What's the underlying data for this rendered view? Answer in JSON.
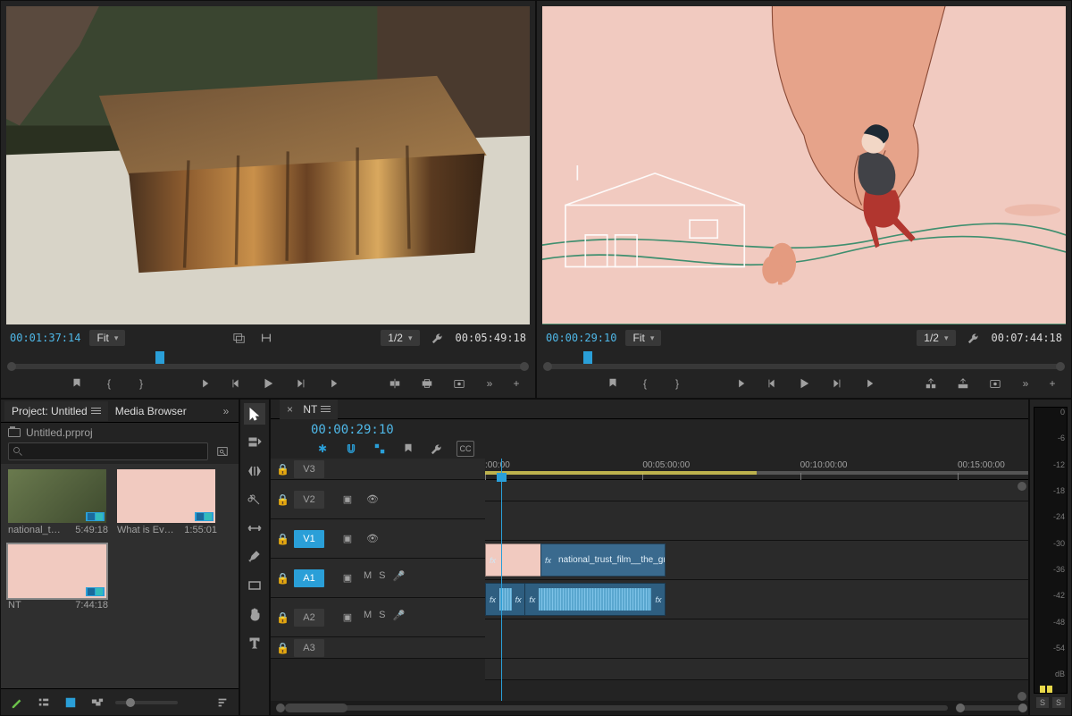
{
  "source": {
    "tc": "00:01:37:14",
    "fit": "Fit",
    "res": "1/2",
    "dur": "00:05:49:18",
    "playhead_pct": 28
  },
  "program": {
    "tc": "00:00:29:10",
    "fit": "Fit",
    "res": "1/2",
    "dur": "00:07:44:18",
    "playhead_pct": 7
  },
  "project": {
    "tabs": {
      "project": "Project: Untitled",
      "media": "Media Browser"
    },
    "file": "Untitled.prproj",
    "search_placeholder": "",
    "bins": [
      {
        "name": "national_t…",
        "dur": "5:49:18",
        "kind": "video"
      },
      {
        "name": "What is Ev…",
        "dur": "1:55:01",
        "kind": "seq"
      },
      {
        "name": "NT",
        "dur": "7:44:18",
        "kind": "seq",
        "sel": true
      }
    ]
  },
  "sequence": {
    "name": "NT",
    "tc": "00:00:29:10",
    "ruler": [
      {
        "label": ":00:00",
        "pct": 0
      },
      {
        "label": "00:05:00:00",
        "pct": 29
      },
      {
        "label": "00:10:00:00",
        "pct": 58
      },
      {
        "label": "00:15:00:00",
        "pct": 87
      }
    ],
    "playhead_pct": 3,
    "inout": {
      "start": 0,
      "end": 50
    },
    "tracks": {
      "v3": "V3",
      "v2": "V2",
      "v1": "V1",
      "a1": "A1",
      "a2": "A2",
      "a3": "A3"
    },
    "v1clips": [
      {
        "start": 0,
        "w": 10.5,
        "label": "",
        "kind": "pink"
      },
      {
        "start": 10.2,
        "w": 23,
        "label": "national_trust_film__the_gr…"
      }
    ],
    "a1clips": [
      {
        "start": 0,
        "w": 7.5
      },
      {
        "start": 7.3,
        "w": 26
      }
    ],
    "track_btns": {
      "m": "M",
      "s": "S"
    }
  },
  "meter": {
    "scale": [
      "0",
      "-6",
      "-12",
      "-18",
      "-24",
      "-30",
      "-36",
      "-42",
      "-48",
      "-54",
      "dB"
    ],
    "solo": "S"
  }
}
